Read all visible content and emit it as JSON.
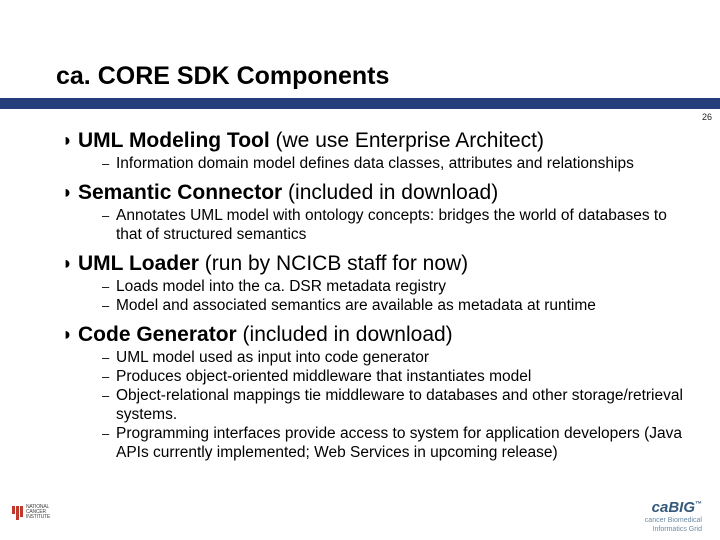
{
  "page_number": "26",
  "title": "ca. CORE SDK Components",
  "bullets": [
    {
      "title_bold": "UML Modeling Tool",
      "title_rest": " (we use Enterprise Architect)",
      "subs": [
        "Information domain model defines data classes, attributes and relationships"
      ]
    },
    {
      "title_bold": "Semantic Connector",
      "title_rest": " (included in download)",
      "subs": [
        "Annotates UML model with ontology concepts: bridges the world of databases to that of structured semantics"
      ]
    },
    {
      "title_bold": "UML Loader",
      "title_rest": " (run by NCICB staff for now)",
      "subs": [
        "Loads model into the ca. DSR metadata registry",
        "Model and associated semantics are available as metadata at runtime"
      ]
    },
    {
      "title_bold": "Code Generator",
      "title_rest": " (included in download)",
      "subs": [
        "UML model used as input into code generator",
        "Produces object-oriented middleware that instantiates model",
        "Object-relational mappings tie middleware to databases and other storage/retrieval systems.",
        "Programming interfaces provide access to system for application developers (Java APIs currently implemented; Web Services in upcoming release)"
      ]
    }
  ],
  "logos": {
    "left_alt": "National Cancer Institute",
    "right_main": "caBIG",
    "right_tm": "™",
    "right_sub1": "cancer Biomedical",
    "right_sub2": "Informatics Grid"
  }
}
